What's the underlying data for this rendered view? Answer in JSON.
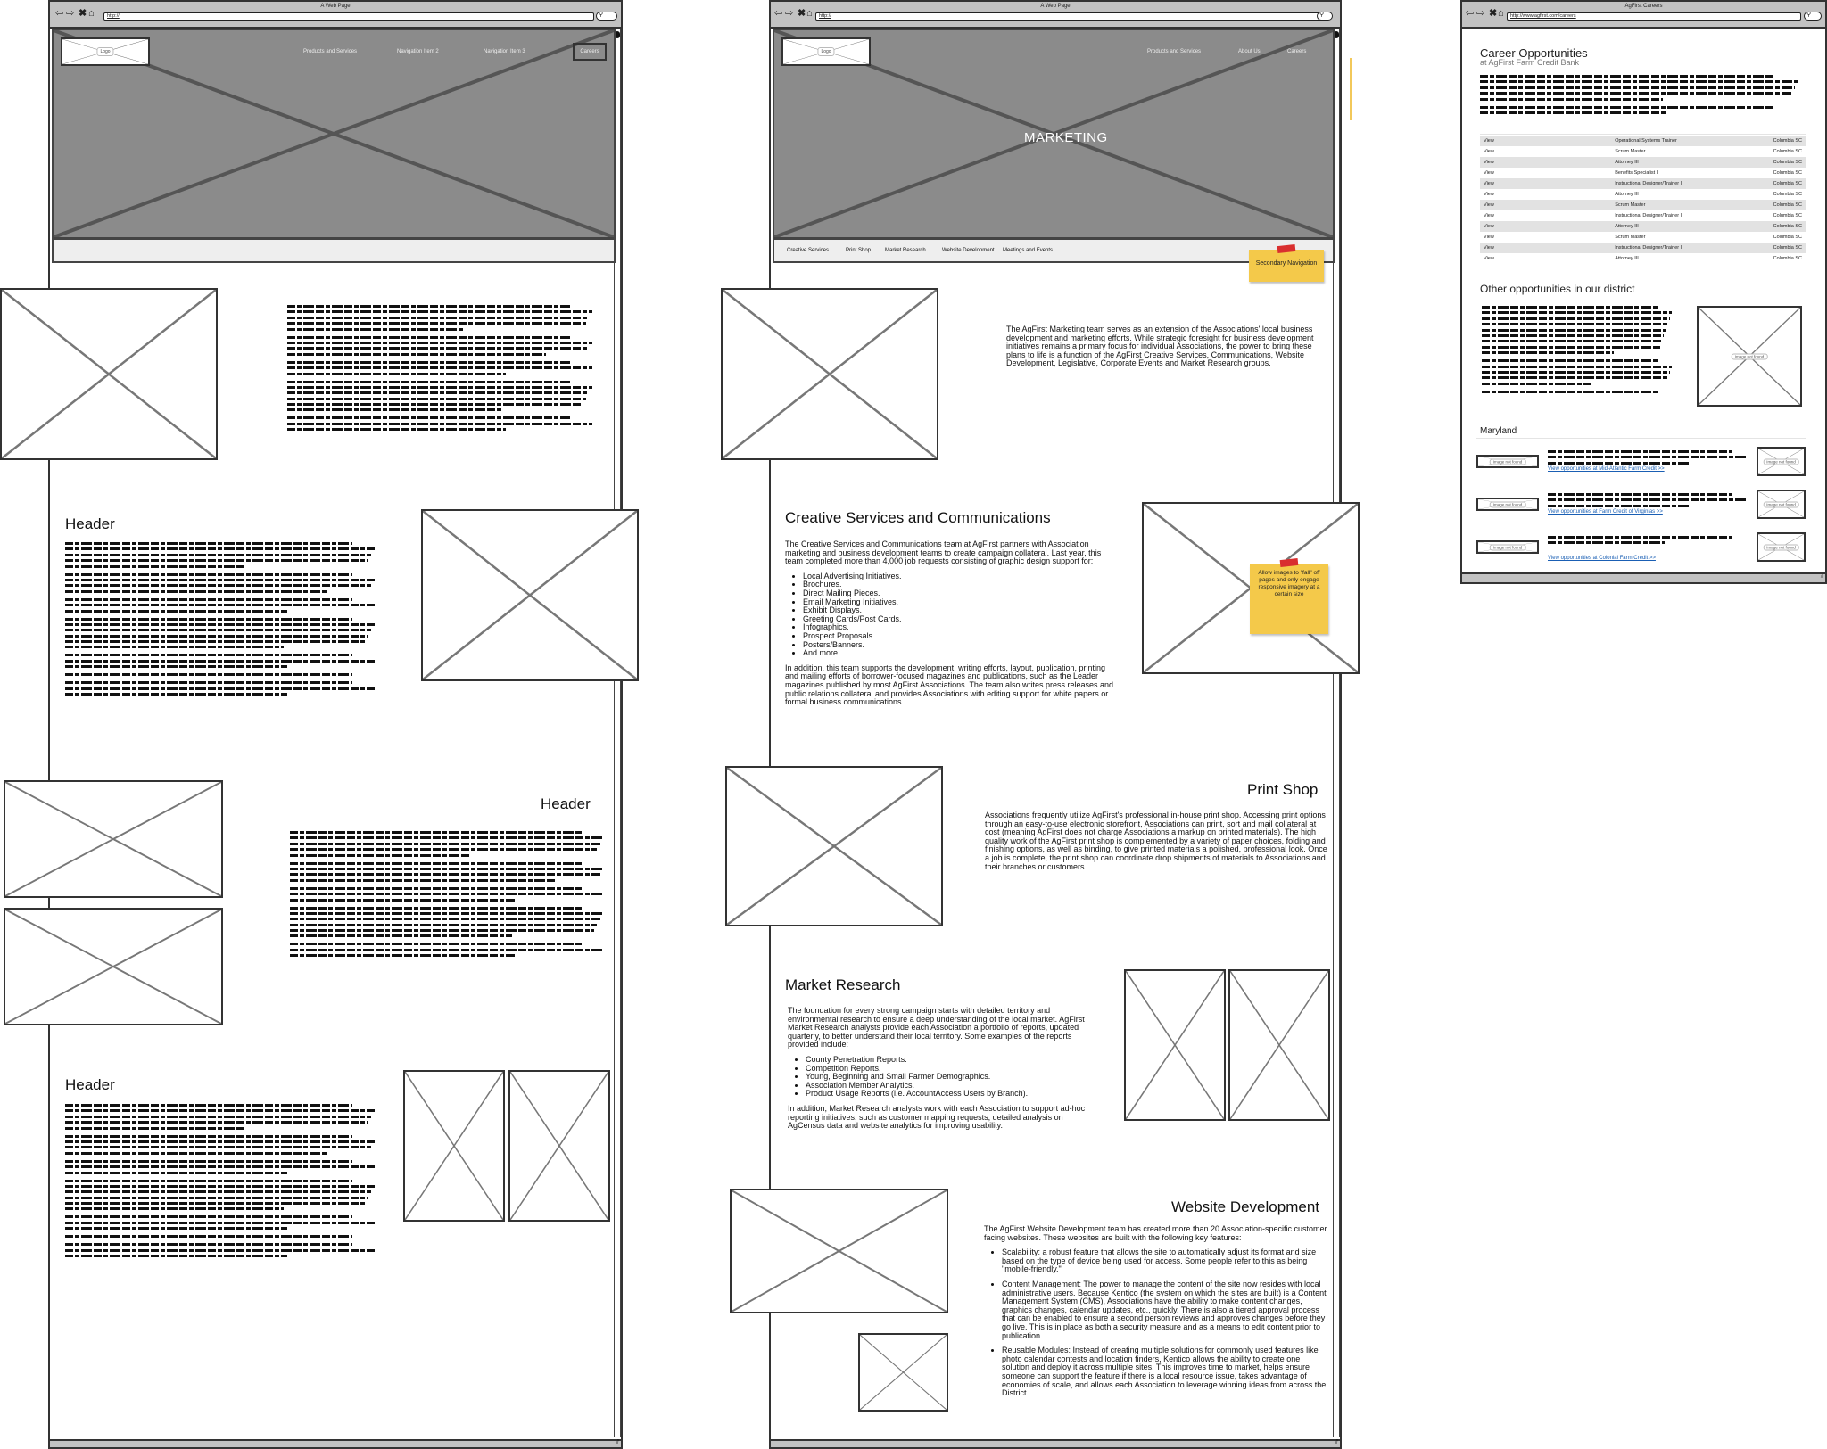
{
  "window1": {
    "title": "A Web Page",
    "url": "http://",
    "nav": [
      "Products and Services",
      "Navigation Item 2",
      "Navigation Item 3"
    ],
    "careers_button": "Careers",
    "logo_label": "Logo",
    "sections": [
      {
        "header": ""
      },
      {
        "header": "Header"
      },
      {
        "header": "Header"
      },
      {
        "header": "Header"
      }
    ]
  },
  "window2": {
    "title": "A Web Page",
    "url": "http://",
    "logo_label": "Logo",
    "nav": [
      "Products and Services",
      "About Us",
      "Careers"
    ],
    "hero_title": "MARKETING",
    "subnav": [
      "Creative Services",
      "Print Shop",
      "Market Research",
      "Website Development",
      "Meetings and Events"
    ],
    "sticky_secondary_nav": "Secondary Navigation",
    "sticky_images_note": "Allow images to \"fall\" off pages and only engage responsive imagery at a certain size",
    "intro": "The AgFirst Marketing team serves as an extension of the Associations' local business development and marketing efforts. While strategic foresight for business development initiatives remains a primary focus for individual Associations, the power to bring these plans to life is a function of the AgFirst Creative Services, Communications, Website Development, Legislative, Corporate Events and Market Research groups.",
    "creative": {
      "title": "Creative Services and Communications",
      "p1": "The Creative Services and Communications team at AgFirst partners with Association marketing and business development teams to create campaign collateral. Last year, this team completed more than 4,000 job requests consisting of graphic design support for:",
      "items": [
        "Local Advertising Initiatives.",
        "Brochures.",
        "Direct Mailing Pieces.",
        "Email Marketing Initiatives.",
        "Exhibit Displays.",
        "Greeting Cards/Post Cards.",
        "Infographics.",
        "Prospect Proposals.",
        "Posters/Banners.",
        "And more."
      ],
      "p2": "In addition, this team supports the development, writing efforts, layout, publication, printing and mailing efforts of borrower-focused magazines and publications, such as the Leader magazines published by most AgFirst Associations. The team also writes press releases and public relations collateral and provides Associations with editing support for white papers or formal business communications."
    },
    "print": {
      "title": "Print Shop",
      "p1": "Associations frequently utilize AgFirst's professional in-house print shop. Accessing print options through an easy-to-use electronic storefront, Associations can print, sort and mail collateral at cost (meaning AgFirst does not charge Associations a markup on printed materials). The high quality work of the AgFirst print shop is complemented by a variety of paper choices, folding and finishing options, as well as binding, to give printed materials a polished, professional look. Once a job is complete, the print shop can coordinate drop shipments of materials to Associations and their branches or customers."
    },
    "research": {
      "title": "Market Research",
      "p1": "The foundation for every strong campaign starts with detailed territory and environmental research to ensure a deep understanding of the local market. AgFirst Market Research analysts provide each Association a portfolio of reports, updated quarterly, to better understand their local territory. Some examples of the reports provided include:",
      "items": [
        "County Penetration Reports.",
        "Competition Reports.",
        "Young, Beginning and Small Farmer Demographics.",
        "Association Member Analytics.",
        "Product Usage Reports (i.e. AccountAccess Users by Branch)."
      ],
      "p2": "In addition, Market Research analysts work with each Association to support ad-hoc reporting initiatives, such as customer mapping requests, detailed analysis on AgCensus data and website analytics for improving usability."
    },
    "webdev": {
      "title": "Website Development",
      "p1": "The AgFirst Website Development team has created more than 20 Association-specific customer facing websites. These websites are built with the following key features:",
      "items": [
        "Scalability: a robust feature that allows the site to automatically adjust its format and size based on the type of device being used for access. Some people refer to this as being \"mobile-friendly.\"",
        "Content Management: The power to manage the content of the site now resides with local administrative users. Because Kentico (the system on which the sites are built) is a Content Management System (CMS), Associations have the ability to make content changes, graphics changes, calendar updates, etc., quickly. There is also a tiered approval process that can be enabled to ensure a second person reviews and approves changes before they go live. This is in place as both a security measure and as a means to edit content prior to publication.",
        "Reusable Modules: Instead of creating multiple solutions for commonly used features like photo calendar contests and location finders, Kentico allows the ability to create one solution and deploy it across multiple sites. This improves time to market, helps ensure someone can support the feature if there is a local resource issue, takes advantage of economies of scale, and allows each Association to leverage winning ideas from across the District."
      ]
    }
  },
  "window3": {
    "title": "AgFirst Careers",
    "url": "http://www.agfirst.com/careers",
    "page_title": "Career Opportunities",
    "page_subtitle": "at AgFirst Farm Credit Bank",
    "jobs": [
      {
        "action": "View",
        "title": "Operational Systems Trainer",
        "location": "Columbia SC"
      },
      {
        "action": "View",
        "title": "Scrum Master",
        "location": "Columbia SC"
      },
      {
        "action": "View",
        "title": "Attorney III",
        "location": "Columbia SC"
      },
      {
        "action": "View",
        "title": "Benefits Specialist I",
        "location": "Columbia SC"
      },
      {
        "action": "View",
        "title": "Instructional Designer/Trainer I",
        "location": "Columbia SC"
      },
      {
        "action": "View",
        "title": "Attorney III",
        "location": "Columbia SC"
      },
      {
        "action": "View",
        "title": "Scrum Master",
        "location": "Columbia SC"
      },
      {
        "action": "View",
        "title": "Instructional Designer/Trainer I",
        "location": "Columbia SC"
      },
      {
        "action": "View",
        "title": "Attorney III",
        "location": "Columbia SC"
      },
      {
        "action": "View",
        "title": "Scrum Master",
        "location": "Columbia SC"
      },
      {
        "action": "View",
        "title": "Instructional Designer/Trainer I",
        "location": "Columbia SC"
      },
      {
        "action": "View",
        "title": "Attorney III",
        "location": "Columbia SC"
      }
    ],
    "other_title": "Other opportunities in our district",
    "image_not_found": "Image not found",
    "region_title": "Maryland",
    "region_links": [
      "View opportunities at Mid-Atlantic Farm Credit >>",
      "View opportunities at Farm Credit of Virginias >>",
      "View opportunities at Colonial Farm Credit >>"
    ]
  }
}
